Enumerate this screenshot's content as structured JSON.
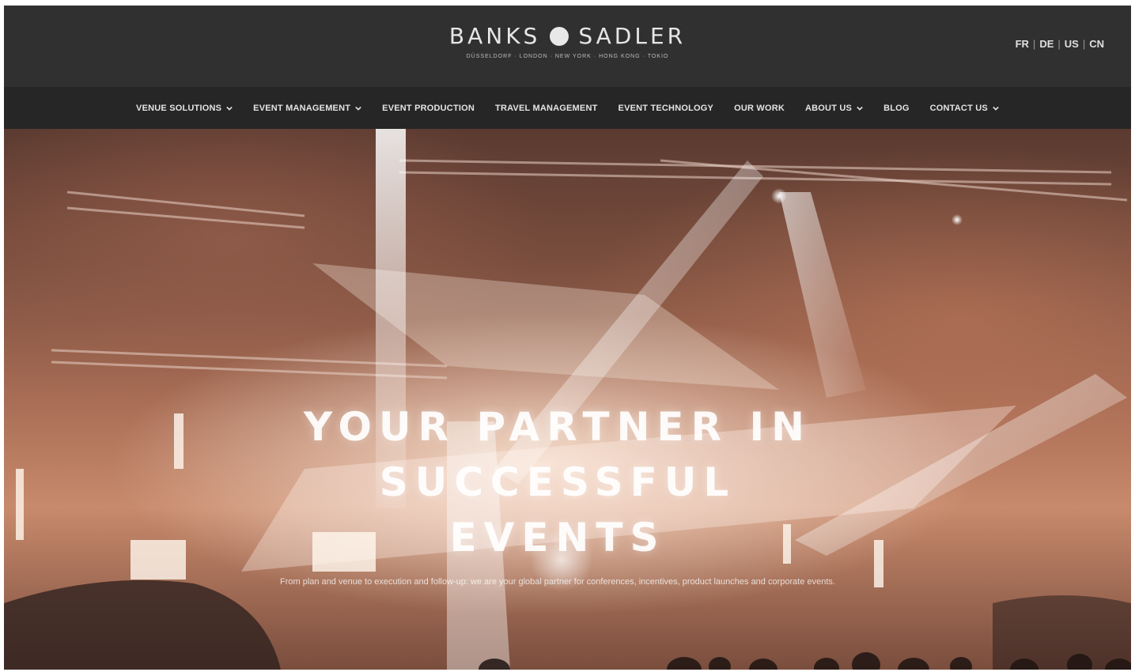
{
  "brand": {
    "name_left": "BANKS",
    "name_right": "SADLER",
    "tagline": "DÜSSELDORF · LONDON · NEW YORK · HONG KONG · TOKIO"
  },
  "languages": [
    "FR",
    "DE",
    "US",
    "CN"
  ],
  "nav": {
    "items": [
      {
        "label": "VENUE SOLUTIONS",
        "dropdown": true
      },
      {
        "label": "EVENT MANAGEMENT",
        "dropdown": true
      },
      {
        "label": "EVENT PRODUCTION",
        "dropdown": false
      },
      {
        "label": "TRAVEL MANAGEMENT",
        "dropdown": false
      },
      {
        "label": "EVENT TECHNOLOGY",
        "dropdown": false
      },
      {
        "label": "OUR WORK",
        "dropdown": false
      },
      {
        "label": "ABOUT US",
        "dropdown": true
      },
      {
        "label": "BLOG",
        "dropdown": false
      },
      {
        "label": "CONTACT US",
        "dropdown": true
      }
    ]
  },
  "hero": {
    "title": "YOUR PARTNER IN SUCCESSFUL EVENTS",
    "subtitle": "From plan and venue to execution and follow-up: we are your global partner for conferences, incentives, product launches and corporate events."
  },
  "colors": {
    "topbar": "#303030",
    "navbar": "#262626",
    "text_light": "#e4e4e4"
  }
}
